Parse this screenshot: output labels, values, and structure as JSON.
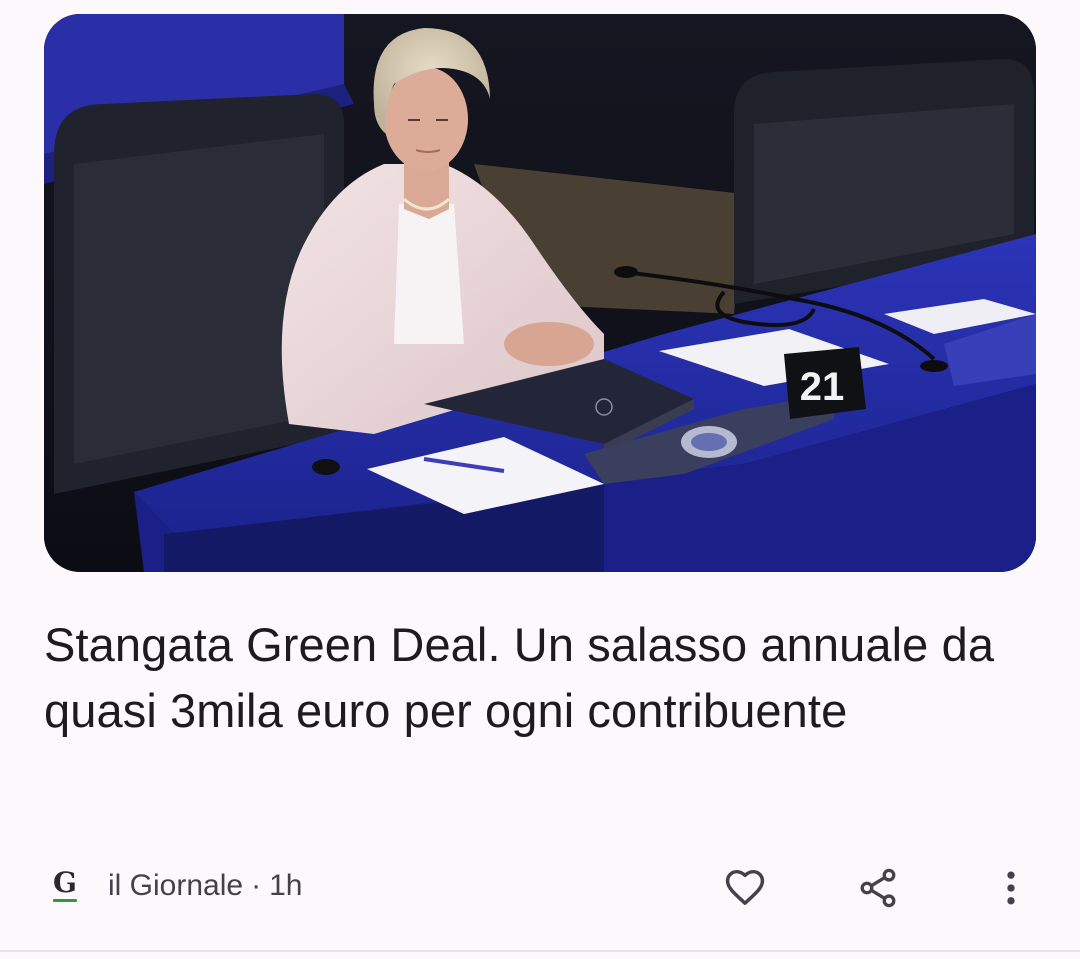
{
  "article": {
    "headline": "Stangata Green Deal. Un salasso annuale da quasi 3mila euro per ogni contribuente",
    "image_alt": "Politician seated at a desk in a parliament chamber",
    "desk_number": "21"
  },
  "source": {
    "logo_letter": "G",
    "name": "il Giornale",
    "separator": "·",
    "time": "1h"
  },
  "actions": {
    "like_icon": "heart-outline-icon",
    "share_icon": "share-icon",
    "more_icon": "more-vert-icon"
  },
  "colors": {
    "background": "#fdf8fb",
    "text": "#1d1b20",
    "meta_text": "#45414a",
    "logo_accent": "#2e9a3a"
  }
}
